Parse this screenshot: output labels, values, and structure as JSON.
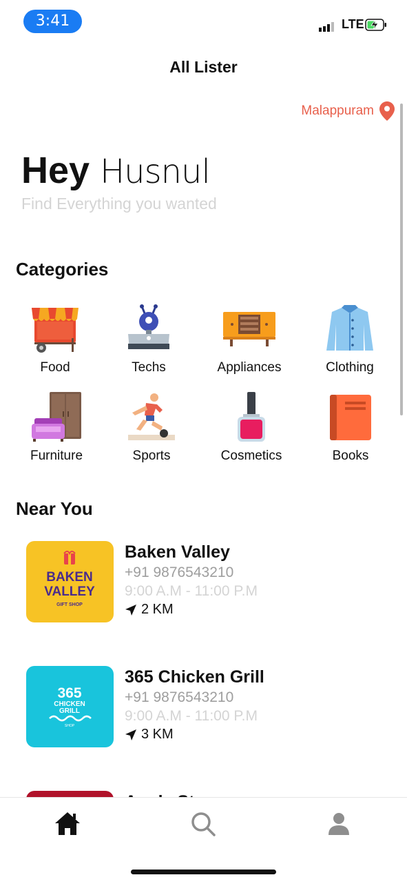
{
  "status_bar": {
    "time": "3:41",
    "network": "LTE",
    "battery_color": "#4cd964",
    "time_pill_color": "#1a7cf3"
  },
  "header": {
    "title": "All Lister"
  },
  "location": {
    "label": "Malappuram",
    "icon": "location-pin-icon",
    "color": "#e8604c"
  },
  "greeting": {
    "hey": "Hey",
    "name": "Husnul",
    "subtitle": "Find Everything you wanted"
  },
  "categories": {
    "title": "Categories",
    "items": [
      {
        "label": "Food",
        "icon": "food-stall-icon"
      },
      {
        "label": "Techs",
        "icon": "tv-icon"
      },
      {
        "label": "Appliances",
        "icon": "cabinet-icon"
      },
      {
        "label": "Clothing",
        "icon": "shirt-icon"
      },
      {
        "label": "Furniture",
        "icon": "sofa-wardrobe-icon"
      },
      {
        "label": "Sports",
        "icon": "football-player-icon"
      },
      {
        "label": "Cosmetics",
        "icon": "nail-polish-icon"
      },
      {
        "label": "Books",
        "icon": "book-icon"
      }
    ]
  },
  "near_you": {
    "title": "Near You",
    "places": [
      {
        "name": "Baken Valley",
        "phone": "+91 9876543210",
        "hours": "9:00 A.M - 11:00 P.M",
        "distance": "2 KM",
        "logo_line1": "BAKEN",
        "logo_line2": "VALLEY",
        "logo_tag": "GIFT SHOP",
        "logo_bg": "#f7c325"
      },
      {
        "name": "365 Chicken Grill",
        "phone": "+91 9876543210",
        "hours": "9:00 A.M - 11:00 P.M",
        "distance": "3 KM",
        "logo_line1": "365",
        "logo_line2": "CHICKEN",
        "logo_line3": "GRILL",
        "logo_tag": "SHOP",
        "logo_bg": "#19c4dc"
      },
      {
        "name": "Apple St",
        "logo_bg": "#b0122a"
      }
    ]
  },
  "tab_bar": {
    "tabs": [
      {
        "icon": "home-icon"
      },
      {
        "icon": "search-icon"
      },
      {
        "icon": "profile-icon"
      }
    ]
  }
}
